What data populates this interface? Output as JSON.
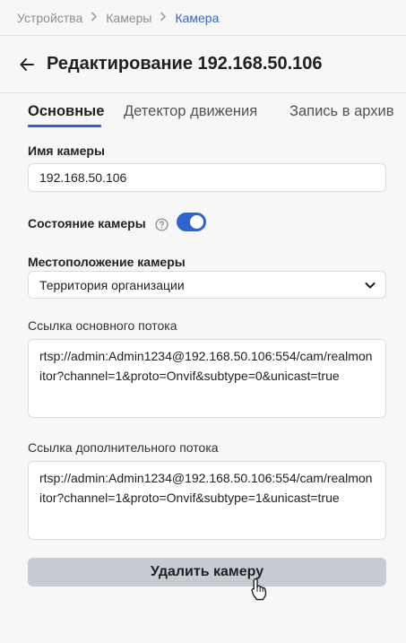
{
  "breadcrumb": {
    "items": [
      "Устройства",
      "Камеры",
      "Камера"
    ]
  },
  "header": {
    "back_icon": "arrow-left-icon",
    "title": "Редактирование 192.168.50.106"
  },
  "tabs": [
    {
      "label": "Основные",
      "active": true
    },
    {
      "label": "Детектор движения",
      "active": false
    },
    {
      "label": "Запись в архив",
      "active": false
    }
  ],
  "form": {
    "camera_name_label": "Имя камеры",
    "camera_name_value": "192.168.50.106",
    "camera_state_label": "Состояние камеры",
    "camera_state_on": true,
    "help_icon": "question-circle-icon",
    "location_label": "Местоположение камеры",
    "location_value": "Территория организации",
    "main_stream_label": "Ссылка основного потока",
    "main_stream_value": "rtsp://admin:Admin1234@192.168.50.106:554/cam/realmonitor?channel=1&proto=Onvif&subtype=0&unicast=true",
    "extra_stream_label": "Ссылка дополнительного потока",
    "extra_stream_value": "rtsp://admin:Admin1234@192.168.50.106:554/cam/realmonitor?channel=1&proto=Onvif&subtype=1&unicast=true"
  },
  "actions": {
    "delete_label": "Удалить камеру"
  },
  "colors": {
    "accent": "#2f63cf",
    "breadcrumb_current": "#3367c9",
    "delete_button_bg": "#c8cbd1"
  }
}
